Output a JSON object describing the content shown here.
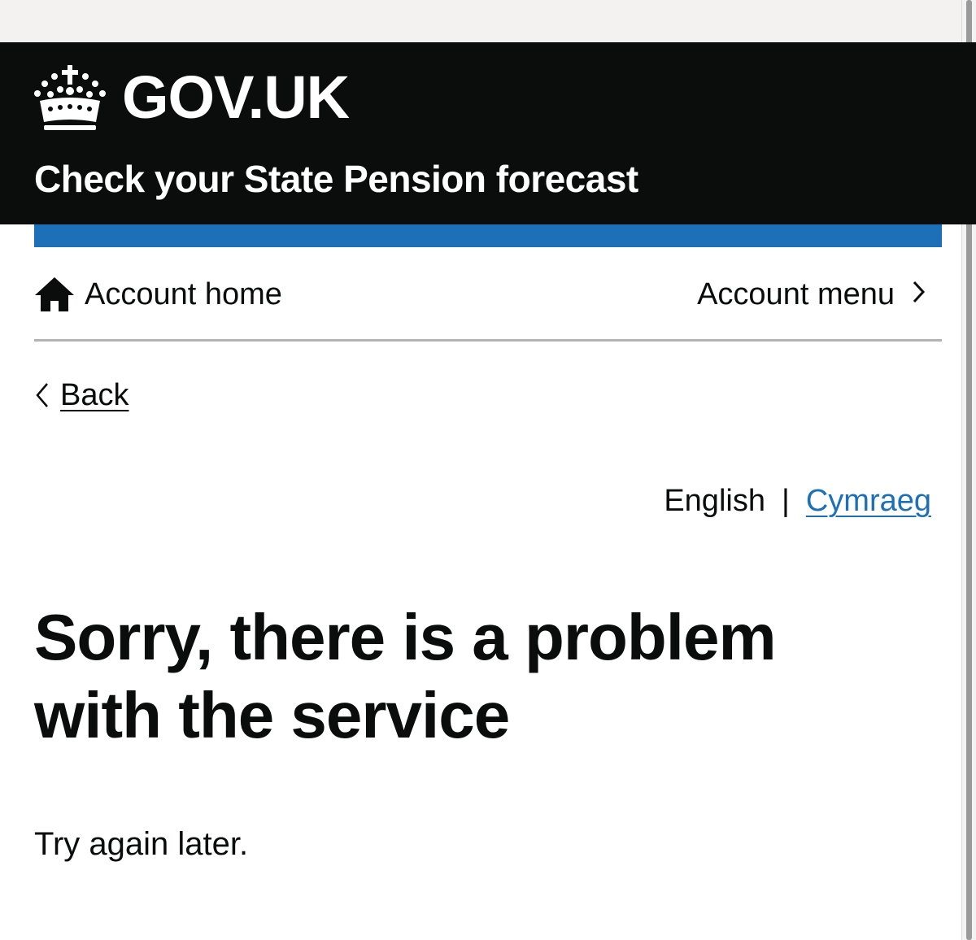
{
  "header": {
    "logo_text": "GOV.UK",
    "service_name": "Check your State Pension forecast"
  },
  "account_nav": {
    "home_label": "Account home",
    "menu_label": "Account menu"
  },
  "back_link": {
    "label": "Back"
  },
  "language_toggle": {
    "current": "English",
    "separator": "|",
    "alternate": "Cymraeg"
  },
  "main": {
    "heading": "Sorry, there is a problem with the service",
    "body": "Try again later."
  },
  "colors": {
    "header_background": "#0b0c0c",
    "service_bar": "#1d70b8",
    "link": "#1d70b8",
    "text": "#0b0c0c",
    "divider": "#b1b4b6"
  }
}
